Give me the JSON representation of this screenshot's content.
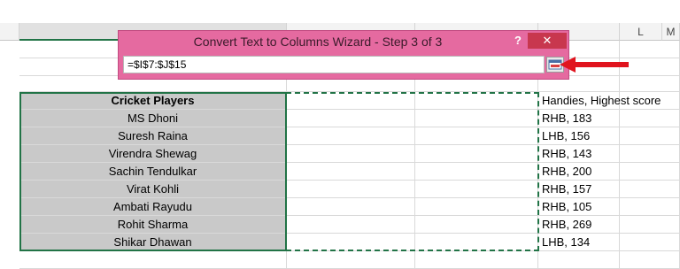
{
  "columns": {
    "headers": [
      "",
      "",
      "",
      "L",
      "M"
    ]
  },
  "dialog": {
    "title": "Convert Text to Columns Wizard - Step 3 of 3",
    "help_label": "?",
    "close_label": "✕",
    "reference_value": "=$I$7:$J$15"
  },
  "sheet": {
    "header_cell": "Cricket Players",
    "j_header": "Handies, Highest score",
    "rows": [
      {
        "player": "MS Dhoni",
        "j": "RHB, 183"
      },
      {
        "player": "Suresh Raina",
        "j": "LHB, 156"
      },
      {
        "player": "Virendra Shewag",
        "j": "RHB, 143"
      },
      {
        "player": "Sachin Tendulkar",
        "j": "RHB, 200"
      },
      {
        "player": "Virat Kohli",
        "j": "RHB, 157"
      },
      {
        "player": "Ambati Rayudu",
        "j": "RHB, 105"
      },
      {
        "player": "Rohit Sharma",
        "j": "RHB, 269"
      },
      {
        "player": "Shikar Dhawan",
        "j": "LHB, 134"
      }
    ]
  },
  "colors": {
    "dialog_bg": "#e56aa0",
    "selection": "#217346",
    "arrow": "#e0141e",
    "highlight_cells": "#c9c9c9"
  },
  "icons": {
    "collapse": "expand-dialog-icon",
    "annotation": "red-arrow-icon"
  }
}
